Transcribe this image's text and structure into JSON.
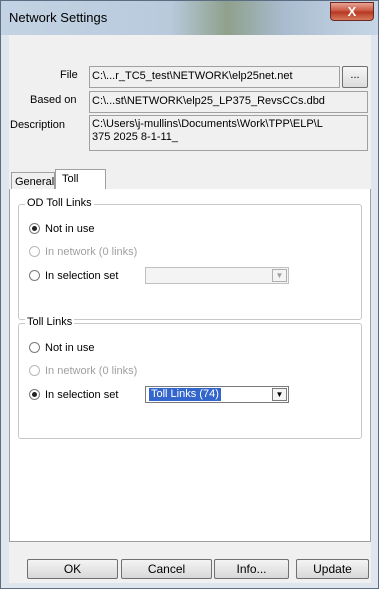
{
  "window": {
    "title": "Network Settings",
    "close_symbol": "X"
  },
  "fields": {
    "file": {
      "label": "File",
      "value": "C:\\...r_TC5_test\\NETWORK\\elp25net.net",
      "browse_label": "..."
    },
    "based_on": {
      "label": "Based on",
      "value": "C:\\...st\\NETWORK\\elp25_LP375_RevsCCs.dbd"
    },
    "description": {
      "label": "Description",
      "line1": "C:\\Users\\j-mullins\\Documents\\Work\\TPP\\ELP\\L",
      "line2": "375 2025 8-1-11_"
    }
  },
  "tabs": [
    {
      "label": "General"
    },
    {
      "label": "Toll"
    }
  ],
  "od_toll_links": {
    "title": "OD Toll Links",
    "options": [
      {
        "label": "Not in use",
        "checked": true,
        "enabled": true
      },
      {
        "label": "In network (0 links)",
        "checked": false,
        "enabled": false
      },
      {
        "label": "In selection set",
        "checked": false,
        "enabled": true
      }
    ],
    "selection_value": ""
  },
  "toll_links": {
    "title": "Toll Links",
    "options": [
      {
        "label": "Not in use",
        "checked": false,
        "enabled": true
      },
      {
        "label": "In network (0 links)",
        "checked": false,
        "enabled": false
      },
      {
        "label": "In selection set",
        "checked": true,
        "enabled": true
      }
    ],
    "selection_value": "Toll Links (74)"
  },
  "buttons": {
    "ok": "OK",
    "cancel": "Cancel",
    "info": "Info...",
    "update": "Update"
  },
  "icons": {
    "dropdown": "chevron-down-icon",
    "close": "close-icon"
  },
  "colors": {
    "selection_highlight": "#3366cc",
    "close_button": "#c7503a"
  }
}
